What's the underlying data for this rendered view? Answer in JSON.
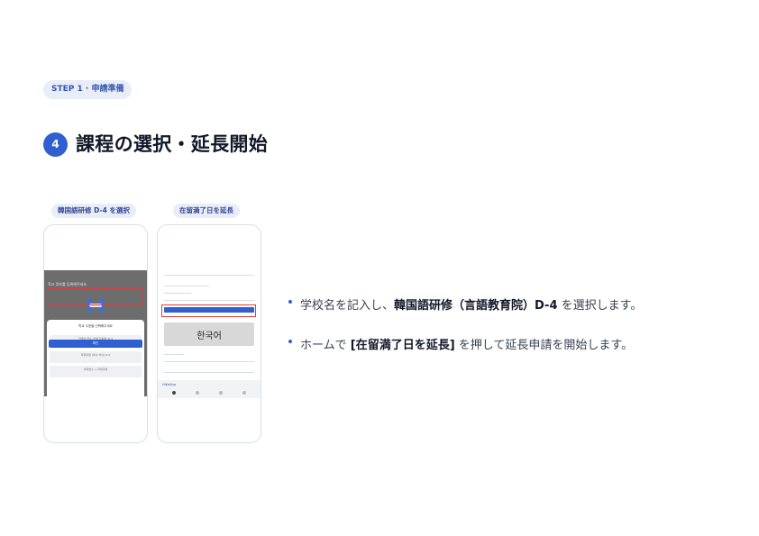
{
  "step_badge": "STEP 1 · 申請準備",
  "step_number": "4",
  "heading": "課程の選択・延長開始",
  "screenshots": [
    {
      "caption": "韓国語研修 D-4 を選択",
      "logo_icon": "hi-korea-logo-icon",
      "top_text": "학교 정보를 등록해주세요",
      "sheet_title": "학교 수준을 선택해주세요",
      "options": [
        "한국어 연수 (언어교육원) D-4",
        "학위과정 (학사·석사) D-2",
        "어학연수 → 학위과정"
      ],
      "confirm": "확인"
    },
    {
      "caption": "在留満了日を延長",
      "korean_label": "한국어",
      "app_name": "HiKoVisa"
    }
  ],
  "bullets": [
    {
      "before": "学校名を記入し、",
      "bold": "韓国語研修（言語教育院）D-4",
      "after": " を選択します。"
    },
    {
      "before": "ホームで ",
      "bold": "[在留満了日を延長]",
      "after": " を押して延長申請を開始します。"
    }
  ],
  "colors": {
    "accent": "#2f5fd0",
    "badge_bg": "#e8edf7",
    "highlight": "#e03b3b"
  }
}
